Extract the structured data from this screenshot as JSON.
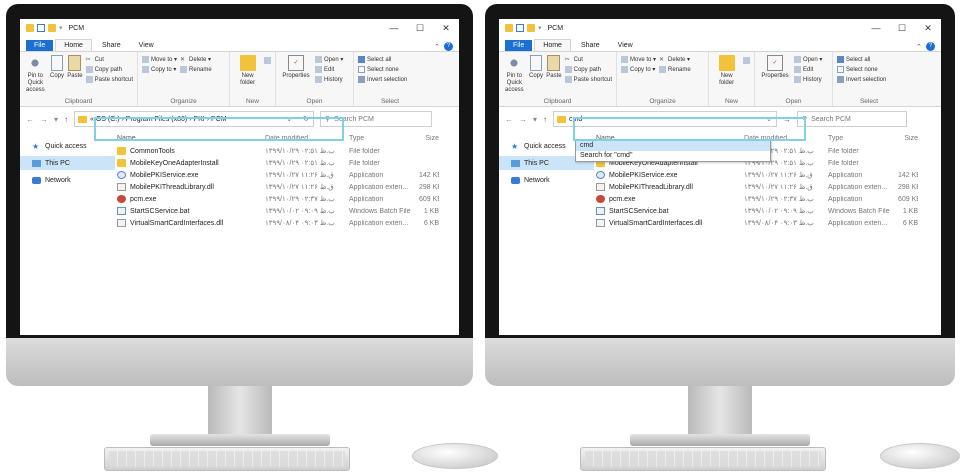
{
  "explorer": {
    "title": "PCM",
    "window_buttons": [
      "—",
      "☐",
      "✕"
    ],
    "tabs": {
      "file": "File",
      "home": "Home",
      "share": "Share",
      "view": "View"
    },
    "ribbon": {
      "pin": "Pin to Quick access",
      "copy": "Copy",
      "paste": "Paste",
      "cut": "Cut",
      "copy_path": "Copy path",
      "paste_shortcut": "Paste shortcut",
      "clipboard": "Clipboard",
      "move_to": "Move to ▾",
      "copy_to": "Copy to ▾",
      "delete": "Delete ▾",
      "rename": "Rename",
      "organize": "Organize",
      "new_folder": "New folder",
      "new": "New",
      "properties": "Properties",
      "open": "Open ▾",
      "edit": "Edit",
      "history": "History",
      "open_group": "Open",
      "select_all": "Select all",
      "select_none": "Select none",
      "invert_selection": "Invert selection",
      "select": "Select"
    },
    "address_path": "«  OS (C:)  ›  Program Files (x86)  ›  PKI  ›  PCM",
    "address_typed": "cmd",
    "search_placeholder": "Search PCM",
    "autocomplete": {
      "first": "cmd",
      "second": "Search for \"cmd\""
    },
    "nav": {
      "quick_access": "Quick access",
      "this_pc": "This PC",
      "network": "Network"
    },
    "columns": {
      "name": "Name",
      "date": "Date modified",
      "type": "Type",
      "size": "Size"
    },
    "files": [
      {
        "name": "CommonTools",
        "date": "۱۳۹۹/۱۰/۲۹ ب.ظ ۰۲:۵۱",
        "type": "File folder",
        "size": ""
      },
      {
        "name": "MobileKeyOneAdapterInstall",
        "date": "۱۳۹۹/۱۰/۲۹ ب.ظ ۰۲:۵۱",
        "type": "File folder",
        "size": ""
      },
      {
        "name": "MobilePKIService.exe",
        "date": "۱۳۹۹/۱۰/۲۷ ق.ظ ۱۱:۲۶",
        "type": "Application",
        "size": "142 KB"
      },
      {
        "name": "MobilePKIThreadLibrary.dll",
        "date": "۱۳۹۹/۱۰/۲۷ ق.ظ ۱۱:۲۶",
        "type": "Application exten...",
        "size": "298 KB"
      },
      {
        "name": "pcm.exe",
        "date": "۱۳۹۹/۱۰/۲۹ ب.ظ ۰۲:۳۷",
        "type": "Application",
        "size": "609 KB"
      },
      {
        "name": "StartSCService.bat",
        "date": "۱۳۹۹/۱۰/۰۲ ب.ظ ۰۹:۰۹",
        "type": "Windows Batch File",
        "size": "1 KB"
      },
      {
        "name": "VirtualSmartCardInterfaces.dll",
        "date": "۱۳۹۹/۰۸/۰۴ ب.ظ ۰۹:۰۳",
        "type": "Application exten...",
        "size": "6 KB"
      }
    ]
  }
}
